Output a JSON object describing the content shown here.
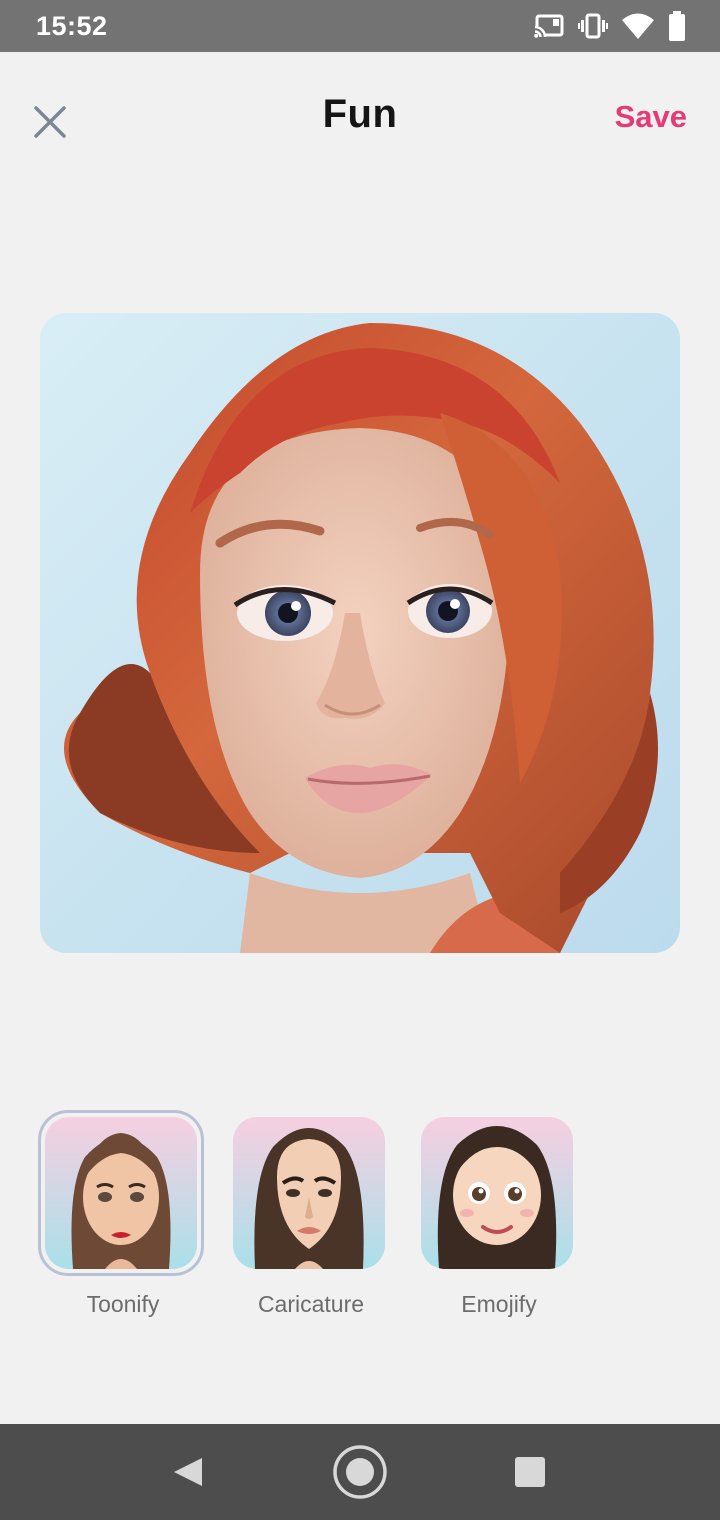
{
  "status_bar": {
    "time": "15:52",
    "icons": [
      "cast-icon",
      "vibrate-icon",
      "wifi-icon",
      "battery-icon"
    ]
  },
  "header": {
    "title": "Fun",
    "save_label": "Save",
    "close_icon": "close-icon"
  },
  "colors": {
    "background": "#f1f1f1",
    "accent": "#e53a74",
    "status_bar": "#737373",
    "nav_bar": "#4d4d4d"
  },
  "styles": [
    {
      "label": "Toonify",
      "selected": true
    },
    {
      "label": "Caricature",
      "selected": false
    },
    {
      "label": "Emojify",
      "selected": false
    }
  ],
  "nav_bar": {
    "icons": [
      "back-icon",
      "home-icon",
      "recents-icon"
    ]
  }
}
